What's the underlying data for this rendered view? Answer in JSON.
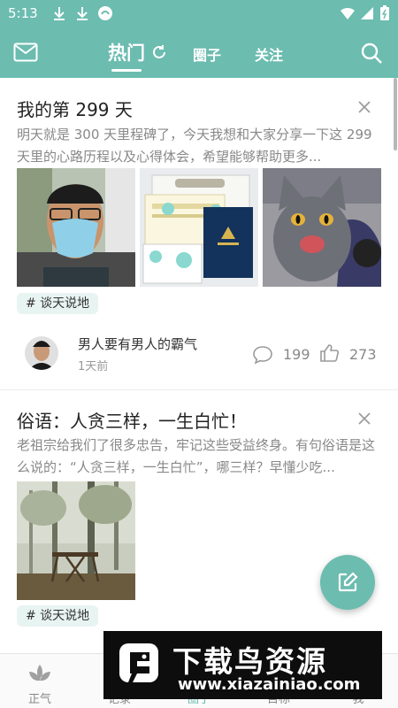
{
  "status_bar": {
    "time": "5:13"
  },
  "top_bar": {
    "tabs": [
      {
        "label": "热门",
        "active": true
      },
      {
        "label": "圈子",
        "active": false
      },
      {
        "label": "关注",
        "active": false
      }
    ]
  },
  "feed": {
    "posts": [
      {
        "title": "我的第 299 天",
        "excerpt": "明天就是 300 天里程碑了，今天我想和大家分享一下这 299 天里的心路历程以及心得体会，希望能够帮助更多...",
        "tag": "# 谈天说地",
        "author": "男人要有男人的霸气",
        "time": "1天前",
        "comments": "199",
        "likes": "273"
      },
      {
        "title": "俗语：人贪三样，一生白忙！",
        "excerpt": "老祖宗给我们了很多忠告，牢记这些受益终身。有句俗语是这么说的：“人贪三样，一生白忙”，哪三样？早懂少吃...",
        "tag": "# 谈天说地"
      }
    ]
  },
  "bottom_nav": {
    "items": [
      {
        "label": "正气",
        "icon": "lotus-icon",
        "active": false
      },
      {
        "label": "记录",
        "icon": "record-icon",
        "active": false
      },
      {
        "label": "圈子",
        "icon": "circle-icon",
        "active": true
      },
      {
        "label": "目标",
        "icon": "target-icon",
        "active": false
      },
      {
        "label": "我",
        "icon": "person-icon",
        "active": false
      }
    ]
  },
  "banner": {
    "title": "下载鸟资源",
    "url": "www.xiazainiao.com"
  },
  "colors": {
    "accent": "#6cbcb0",
    "tag_bg": "#e8f4f2",
    "muted_text": "#888888"
  }
}
